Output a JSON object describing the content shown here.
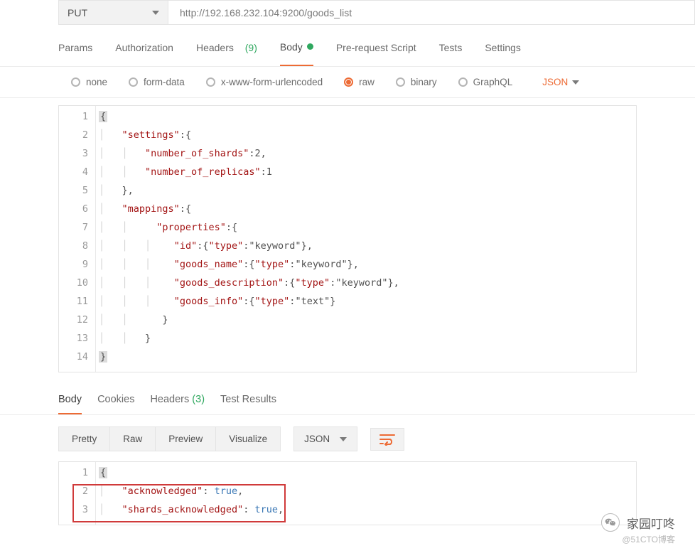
{
  "request": {
    "method": "PUT",
    "url": "http://192.168.232.104:9200/goods_list"
  },
  "tabs": {
    "params": "Params",
    "authorization": "Authorization",
    "headers": "Headers",
    "headers_count": "(9)",
    "body": "Body",
    "prerequest": "Pre-request Script",
    "tests": "Tests",
    "settings": "Settings"
  },
  "body_types": {
    "none": "none",
    "formdata": "form-data",
    "xform": "x-www-form-urlencoded",
    "raw": "raw",
    "binary": "binary",
    "graphql": "GraphQL",
    "lang": "JSON"
  },
  "request_body_lines": [
    "{",
    "    \"settings\":{",
    "        \"number_of_shards\":2,",
    "        \"number_of_replicas\":1",
    "    },",
    "    \"mappings\":{",
    "          \"properties\":{",
    "             \"id\":{\"type\":\"keyword\"},",
    "             \"goods_name\":{\"type\":\"keyword\"},",
    "             \"goods_description\":{\"type\":\"keyword\"},",
    "             \"goods_info\":{\"type\":\"text\"}",
    "           }",
    "        }",
    "}"
  ],
  "response_tabs": {
    "body": "Body",
    "cookies": "Cookies",
    "headers": "Headers",
    "headers_count": "(3)",
    "test_results": "Test Results"
  },
  "view_modes": {
    "pretty": "Pretty",
    "raw": "Raw",
    "preview": "Preview",
    "visualize": "Visualize",
    "json": "JSON"
  },
  "response_body_lines": [
    "{",
    "    \"acknowledged\": true,",
    "    \"shards_acknowledged\": true,"
  ],
  "brand": {
    "line1": "家园叮咚",
    "line2": "@51CTO博客"
  }
}
